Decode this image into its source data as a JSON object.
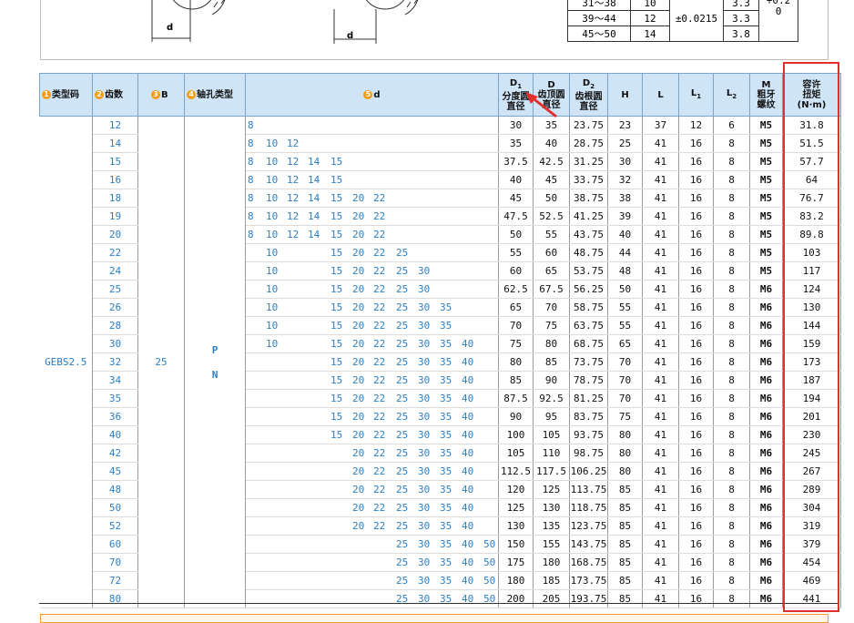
{
  "diagram": {
    "dim_left": "d",
    "dim_right": "d"
  },
  "tolerance_table": {
    "rows": [
      {
        "range": "31〜38",
        "value": "10",
        "tol": "",
        "x": "3.3"
      },
      {
        "range": "39〜44",
        "value": "12",
        "tol": "±0.0215",
        "x": "3.3"
      },
      {
        "range": "45〜50",
        "value": "14",
        "tol": "",
        "x": "3.8"
      }
    ],
    "side_value": "+0.2\n0"
  },
  "headers": {
    "type_code": "类型码",
    "teeth": "齿数",
    "b": "B",
    "bore_type": "轴孔类型",
    "d": "d",
    "d1_line1": "D",
    "d1_sub": "1",
    "d1_line2": "分度圆",
    "d1_line3": "直径",
    "dd_line1": "D",
    "dd_line2": "齿顶圆",
    "dd_line3": "直径",
    "d2_line1": "D",
    "d2_sub": "2",
    "d2_line2": "齿根圆",
    "d2_line3": "直径",
    "h": "H",
    "l": "L",
    "l1": "L",
    "l1_sub": "1",
    "l2": "L",
    "l2_sub": "2",
    "m_line1": "M",
    "m_line2": "粗牙",
    "m_line3": "螺纹",
    "torque_line1": "容许",
    "torque_line2": "扭矩",
    "torque_line3": "(N·m)",
    "circle1": "1",
    "circle2": "2",
    "circle3": "3",
    "circle4": "4",
    "circle5": "5"
  },
  "type_code": "GEBS2.5",
  "b_value": "25",
  "bore_type_1": "P",
  "bore_type_2": "N",
  "d_columns": [
    "8",
    "10",
    "12",
    "14",
    "15",
    "20",
    "22",
    "25",
    "30",
    "35",
    "40",
    "50"
  ],
  "rows": [
    {
      "teeth": "12",
      "d": [
        "8"
      ],
      "d1": "30",
      "dd": "35",
      "d2": "23.75",
      "h": "23",
      "l": "37",
      "l1": "12",
      "l2": "6",
      "m": "M5",
      "torque": "31.8"
    },
    {
      "teeth": "14",
      "d": [
        "8",
        "10",
        "12"
      ],
      "d1": "35",
      "dd": "40",
      "d2": "28.75",
      "h": "25",
      "l": "41",
      "l1": "16",
      "l2": "8",
      "m": "M5",
      "torque": "51.5"
    },
    {
      "teeth": "15",
      "d": [
        "8",
        "10",
        "12",
        "14",
        "15"
      ],
      "d1": "37.5",
      "dd": "42.5",
      "d2": "31.25",
      "h": "30",
      "l": "41",
      "l1": "16",
      "l2": "8",
      "m": "M5",
      "torque": "57.7"
    },
    {
      "teeth": "16",
      "d": [
        "8",
        "10",
        "12",
        "14",
        "15"
      ],
      "d1": "40",
      "dd": "45",
      "d2": "33.75",
      "h": "32",
      "l": "41",
      "l1": "16",
      "l2": "8",
      "m": "M5",
      "torque": "64"
    },
    {
      "teeth": "18",
      "d": [
        "8",
        "10",
        "12",
        "14",
        "15",
        "20",
        "22"
      ],
      "d1": "45",
      "dd": "50",
      "d2": "38.75",
      "h": "38",
      "l": "41",
      "l1": "16",
      "l2": "8",
      "m": "M5",
      "torque": "76.7"
    },
    {
      "teeth": "19",
      "d": [
        "8",
        "10",
        "12",
        "14",
        "15",
        "20",
        "22"
      ],
      "d1": "47.5",
      "dd": "52.5",
      "d2": "41.25",
      "h": "39",
      "l": "41",
      "l1": "16",
      "l2": "8",
      "m": "M5",
      "torque": "83.2"
    },
    {
      "teeth": "20",
      "d": [
        "8",
        "10",
        "12",
        "14",
        "15",
        "20",
        "22"
      ],
      "d1": "50",
      "dd": "55",
      "d2": "43.75",
      "h": "40",
      "l": "41",
      "l1": "16",
      "l2": "8",
      "m": "M5",
      "torque": "89.8"
    },
    {
      "teeth": "22",
      "d": [
        "10",
        "15",
        "20",
        "22",
        "25"
      ],
      "d1": "55",
      "dd": "60",
      "d2": "48.75",
      "h": "44",
      "l": "41",
      "l1": "16",
      "l2": "8",
      "m": "M5",
      "torque": "103"
    },
    {
      "teeth": "24",
      "d": [
        "10",
        "15",
        "20",
        "22",
        "25",
        "30"
      ],
      "d1": "60",
      "dd": "65",
      "d2": "53.75",
      "h": "48",
      "l": "41",
      "l1": "16",
      "l2": "8",
      "m": "M5",
      "torque": "117"
    },
    {
      "teeth": "25",
      "d": [
        "10",
        "15",
        "20",
        "22",
        "25",
        "30"
      ],
      "d1": "62.5",
      "dd": "67.5",
      "d2": "56.25",
      "h": "50",
      "l": "41",
      "l1": "16",
      "l2": "8",
      "m": "M6",
      "torque": "124"
    },
    {
      "teeth": "26",
      "d": [
        "10",
        "15",
        "20",
        "22",
        "25",
        "30",
        "35"
      ],
      "d1": "65",
      "dd": "70",
      "d2": "58.75",
      "h": "55",
      "l": "41",
      "l1": "16",
      "l2": "8",
      "m": "M6",
      "torque": "130"
    },
    {
      "teeth": "28",
      "d": [
        "10",
        "15",
        "20",
        "22",
        "25",
        "30",
        "35"
      ],
      "d1": "70",
      "dd": "75",
      "d2": "63.75",
      "h": "55",
      "l": "41",
      "l1": "16",
      "l2": "8",
      "m": "M6",
      "torque": "144"
    },
    {
      "teeth": "30",
      "d": [
        "10",
        "15",
        "20",
        "22",
        "25",
        "30",
        "35",
        "40"
      ],
      "d1": "75",
      "dd": "80",
      "d2": "68.75",
      "h": "65",
      "l": "41",
      "l1": "16",
      "l2": "8",
      "m": "M6",
      "torque": "159"
    },
    {
      "teeth": "32",
      "d": [
        "15",
        "20",
        "22",
        "25",
        "30",
        "35",
        "40"
      ],
      "d1": "80",
      "dd": "85",
      "d2": "73.75",
      "h": "70",
      "l": "41",
      "l1": "16",
      "l2": "8",
      "m": "M6",
      "torque": "173"
    },
    {
      "teeth": "34",
      "d": [
        "15",
        "20",
        "22",
        "25",
        "30",
        "35",
        "40"
      ],
      "d1": "85",
      "dd": "90",
      "d2": "78.75",
      "h": "70",
      "l": "41",
      "l1": "16",
      "l2": "8",
      "m": "M6",
      "torque": "187"
    },
    {
      "teeth": "35",
      "d": [
        "15",
        "20",
        "22",
        "25",
        "30",
        "35",
        "40"
      ],
      "d1": "87.5",
      "dd": "92.5",
      "d2": "81.25",
      "h": "70",
      "l": "41",
      "l1": "16",
      "l2": "8",
      "m": "M6",
      "torque": "194"
    },
    {
      "teeth": "36",
      "d": [
        "15",
        "20",
        "22",
        "25",
        "30",
        "35",
        "40"
      ],
      "d1": "90",
      "dd": "95",
      "d2": "83.75",
      "h": "75",
      "l": "41",
      "l1": "16",
      "l2": "8",
      "m": "M6",
      "torque": "201"
    },
    {
      "teeth": "40",
      "d": [
        "15",
        "20",
        "22",
        "25",
        "30",
        "35",
        "40"
      ],
      "d1": "100",
      "dd": "105",
      "d2": "93.75",
      "h": "80",
      "l": "41",
      "l1": "16",
      "l2": "8",
      "m": "M6",
      "torque": "230"
    },
    {
      "teeth": "42",
      "d": [
        "20",
        "22",
        "25",
        "30",
        "35",
        "40"
      ],
      "d1": "105",
      "dd": "110",
      "d2": "98.75",
      "h": "80",
      "l": "41",
      "l1": "16",
      "l2": "8",
      "m": "M6",
      "torque": "245"
    },
    {
      "teeth": "45",
      "d": [
        "20",
        "22",
        "25",
        "30",
        "35",
        "40"
      ],
      "d1": "112.5",
      "dd": "117.5",
      "d2": "106.25",
      "h": "80",
      "l": "41",
      "l1": "16",
      "l2": "8",
      "m": "M6",
      "torque": "267"
    },
    {
      "teeth": "48",
      "d": [
        "20",
        "22",
        "25",
        "30",
        "35",
        "40"
      ],
      "d1": "120",
      "dd": "125",
      "d2": "113.75",
      "h": "85",
      "l": "41",
      "l1": "16",
      "l2": "8",
      "m": "M6",
      "torque": "289"
    },
    {
      "teeth": "50",
      "d": [
        "20",
        "22",
        "25",
        "30",
        "35",
        "40"
      ],
      "d1": "125",
      "dd": "130",
      "d2": "118.75",
      "h": "85",
      "l": "41",
      "l1": "16",
      "l2": "8",
      "m": "M6",
      "torque": "304"
    },
    {
      "teeth": "52",
      "d": [
        "20",
        "22",
        "25",
        "30",
        "35",
        "40"
      ],
      "d1": "130",
      "dd": "135",
      "d2": "123.75",
      "h": "85",
      "l": "41",
      "l1": "16",
      "l2": "8",
      "m": "M6",
      "torque": "319"
    },
    {
      "teeth": "60",
      "d": [
        "25",
        "30",
        "35",
        "40",
        "50"
      ],
      "d1": "150",
      "dd": "155",
      "d2": "143.75",
      "h": "85",
      "l": "41",
      "l1": "16",
      "l2": "8",
      "m": "M6",
      "torque": "379"
    },
    {
      "teeth": "70",
      "d": [
        "25",
        "30",
        "35",
        "40",
        "50"
      ],
      "d1": "175",
      "dd": "180",
      "d2": "168.75",
      "h": "85",
      "l": "41",
      "l1": "16",
      "l2": "8",
      "m": "M6",
      "torque": "454"
    },
    {
      "teeth": "72",
      "d": [
        "25",
        "30",
        "35",
        "40",
        "50"
      ],
      "d1": "180",
      "dd": "185",
      "d2": "173.75",
      "h": "85",
      "l": "41",
      "l1": "16",
      "l2": "8",
      "m": "M6",
      "torque": "469"
    },
    {
      "teeth": "80",
      "d": [
        "25",
        "30",
        "35",
        "40",
        "50"
      ],
      "d1": "200",
      "dd": "205",
      "d2": "193.75",
      "h": "85",
      "l": "41",
      "l1": "16",
      "l2": "8",
      "m": "M6",
      "torque": "441"
    }
  ]
}
